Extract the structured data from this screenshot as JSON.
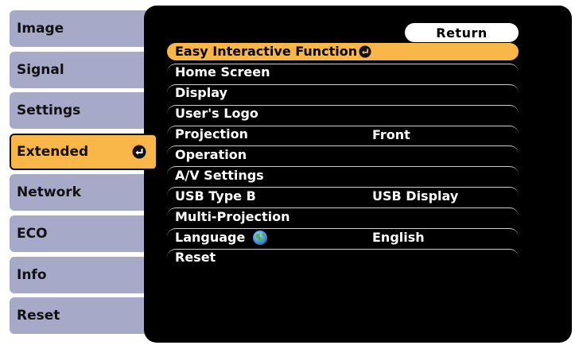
{
  "sidebar": {
    "tabs": [
      {
        "label": "Image",
        "active": false
      },
      {
        "label": "Signal",
        "active": false
      },
      {
        "label": "Settings",
        "active": false
      },
      {
        "label": "Extended",
        "active": true
      },
      {
        "label": "Network",
        "active": false
      },
      {
        "label": "ECO",
        "active": false
      },
      {
        "label": "Info",
        "active": false
      },
      {
        "label": "Reset",
        "active": false
      }
    ]
  },
  "main": {
    "return_label": "Return",
    "items": [
      {
        "label": "Easy Interactive Function",
        "value": "",
        "selected": true,
        "icon": "enter-icon"
      },
      {
        "label": "Home Screen",
        "value": ""
      },
      {
        "label": "Display",
        "value": ""
      },
      {
        "label": "User's Logo",
        "value": ""
      },
      {
        "label": "Projection",
        "value": "Front"
      },
      {
        "label": "Operation",
        "value": ""
      },
      {
        "label": "A/V Settings",
        "value": ""
      },
      {
        "label": "USB Type B",
        "value": "USB Display"
      },
      {
        "label": "Multi-Projection",
        "value": ""
      },
      {
        "label": "Language",
        "value": "English",
        "icon": "globe-icon"
      },
      {
        "label": "Reset",
        "value": ""
      }
    ]
  },
  "colors": {
    "tab_bg": "#a7a9c9",
    "highlight": "#f9b74a",
    "panel_bg": "#000000",
    "text_light": "#ffffff"
  }
}
